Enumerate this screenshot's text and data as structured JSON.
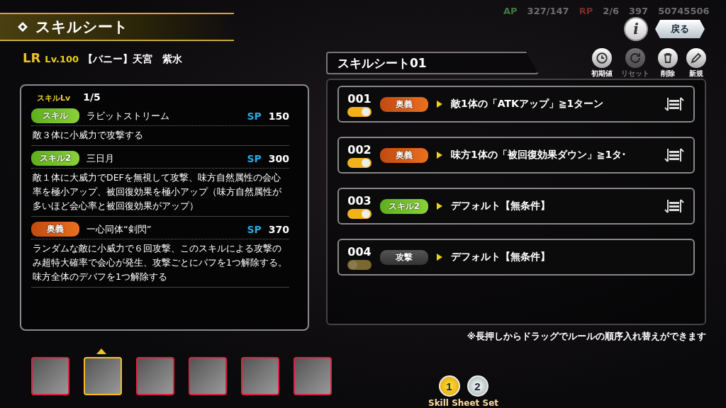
{
  "header": {
    "title": "スキルシート",
    "info": "i",
    "back": "戻る"
  },
  "status": {
    "ap_label": "AP",
    "ap": "327/147",
    "rp_label": "RP",
    "rp": "2/6",
    "gems": "397",
    "coins": "50745506"
  },
  "character": {
    "rarity": "LR",
    "level": "Lv.100",
    "name": "【バニー】天宮　紫水"
  },
  "skill_panel": {
    "level_label": "スキルLv",
    "level": "1/5",
    "skills": [
      {
        "kind": "skill",
        "tag": "スキル",
        "name": "ラビットストリーム",
        "sp_label": "SP",
        "sp": "150",
        "description": "敵３体に小威力で攻撃する"
      },
      {
        "kind": "skill",
        "tag": "スキル2",
        "name": "三日月",
        "sp_label": "SP",
        "sp": "300",
        "description": "敵１体に大威力でDEFを無視して攻撃、味方自然属性の会心率を極小アップ、被回復効果を極小アップ（味方自然属性が多いほど会心率と被回復効果がアップ）"
      },
      {
        "kind": "ougi",
        "tag": "奥義",
        "name": "一心同体“剣閃”",
        "sp_label": "SP",
        "sp": "370",
        "description": "ランダムな敵に小威力で６回攻撃、このスキルによる攻撃のみ超特大確率で会心が発生、攻撃ごとにバフを1つ解除する。味方全体のデバフを1つ解除する"
      }
    ]
  },
  "sheet": {
    "title": "スキルシート01",
    "tools": [
      {
        "kind": "default",
        "label": "初期値",
        "disabled": false
      },
      {
        "kind": "reset",
        "label": "リセット",
        "disabled": true
      },
      {
        "kind": "delete",
        "label": "削除",
        "disabled": false
      },
      {
        "kind": "new",
        "label": "新規",
        "disabled": false
      }
    ],
    "rules": [
      {
        "number": "001",
        "on": true,
        "kind": "ougi",
        "tag": "奥義",
        "condition": "敵1体の「ATKアップ」≧1ターン",
        "sortable": true
      },
      {
        "number": "002",
        "on": true,
        "kind": "ougi",
        "tag": "奥義",
        "condition": "味方1体の「被回復効果ダウン」≧1タ·",
        "sortable": true
      },
      {
        "number": "003",
        "on": true,
        "kind": "skill",
        "tag": "スキル2",
        "condition": "デフォルト【無条件】",
        "sortable": true
      },
      {
        "number": "004",
        "on": false,
        "kind": "attack",
        "tag": "攻撃",
        "condition": "デフォルト【無条件】",
        "sortable": false
      }
    ],
    "note": "※長押しからドラッグでルールの順序入れ替えができます"
  },
  "party": [
    {
      "selected": false
    },
    {
      "selected": true
    },
    {
      "selected": false
    },
    {
      "selected": false
    },
    {
      "selected": false
    },
    {
      "selected": false
    }
  ],
  "sets": {
    "label": "Skill Sheet Set",
    "pages": [
      {
        "label": "1",
        "selected": true
      },
      {
        "label": "2",
        "selected": false
      }
    ]
  }
}
